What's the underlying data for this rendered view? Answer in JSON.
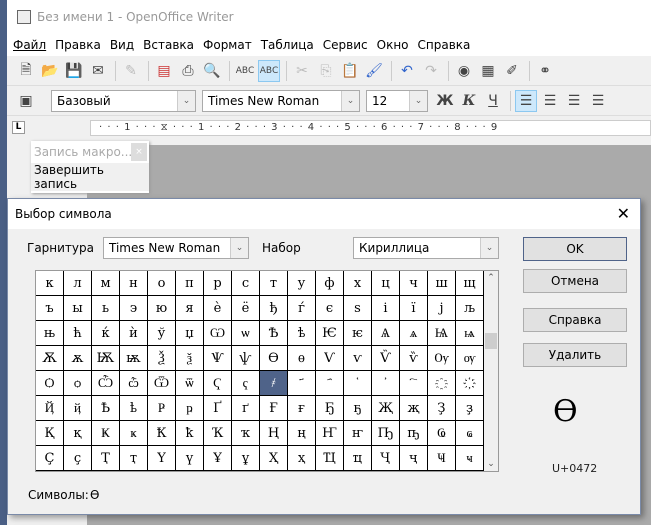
{
  "app": {
    "title": "Без имени 1 - OpenOffice Writer"
  },
  "menu": [
    "Файл",
    "Правка",
    "Вид",
    "Вставка",
    "Формат",
    "Таблица",
    "Сервис",
    "Окно",
    "Справка"
  ],
  "format_bar": {
    "style": "Базовый",
    "font": "Times New Roman",
    "size": "12",
    "bold": "Ж",
    "italic": "К",
    "underline": "Ч"
  },
  "ruler": {
    "labels": "· · · 1 · · · ⧖ · · · 1 · · · 2 · · · 3 · · · 4 · · · 5 · · · 6 · · · 7 · · · 8 · · · 9"
  },
  "macro_toolbar": {
    "title": "Запись макро...",
    "stop": "Завершить запись"
  },
  "dialog": {
    "title": "Выбор символа",
    "font_label": "Гарнитура",
    "font_value": "Times New Roman",
    "subset_label": "Набор",
    "subset_value": "Кириллица",
    "buttons": {
      "ok": "OK",
      "cancel": "Отмена",
      "help": "Справка",
      "delete": "Удалить"
    },
    "preview_char": "Ѳ",
    "code": "U+0472",
    "symbols_label": "Символы:",
    "symbols_value": "Ѳ",
    "selected_index": 72,
    "chars": [
      "к",
      "л",
      "м",
      "н",
      "о",
      "п",
      "р",
      "с",
      "т",
      "у",
      "ф",
      "х",
      "ц",
      "ч",
      "ш",
      "щ",
      "ъ",
      "ы",
      "ь",
      "э",
      "ю",
      "я",
      "ѐ",
      "ё",
      "ђ",
      "ѓ",
      "є",
      "ѕ",
      "і",
      "ї",
      "ј",
      "љ",
      "њ",
      "ћ",
      "ќ",
      "ѝ",
      "ў",
      "џ",
      "Ѡ",
      "ѡ",
      "Ѣ",
      "ѣ",
      "Ѥ",
      "ѥ",
      "Ѧ",
      "ѧ",
      "Ѩ",
      "ѩ",
      "Ѫ",
      "ѫ",
      "Ѭ",
      "ѭ",
      "Ѯ",
      "ѯ",
      "Ѱ",
      "ѱ",
      "Ѳ",
      "ѳ",
      "Ѵ",
      "ѵ",
      "Ѷ",
      "ѷ",
      "Ѹ",
      "ѹ",
      "Ѻ",
      "ѻ",
      "Ѽ",
      "ѽ",
      "Ѿ",
      "ѿ",
      "Ҁ",
      "ҁ",
      "҂",
      " ҃",
      " ҄",
      " ҅",
      " ҆",
      " ҇",
      " ҈",
      " ҉",
      "Ҋ",
      "ҋ",
      "Ҍ",
      "ҍ",
      "Ҏ",
      "ҏ",
      "Ґ",
      "ґ",
      "Ғ",
      "ғ",
      "Ҕ",
      "ҕ",
      "Җ",
      "җ",
      "Ҙ",
      "ҙ",
      "Қ",
      "қ",
      "Ҝ",
      "ҝ",
      "Ҟ",
      "ҟ",
      "Ҡ",
      "ҡ",
      "Ң",
      "ң",
      "Ҥ",
      "ҥ",
      "Ҧ",
      "ҧ",
      "Ҩ",
      "ҩ",
      "Ҫ",
      "ҫ",
      "Ҭ",
      "ҭ",
      "Ү",
      "ү",
      "Ұ",
      "ұ",
      "Ҳ",
      "ҳ",
      "Ҵ",
      "ҵ",
      "Ҷ",
      "ҷ",
      "Ҹ",
      "ҹ"
    ]
  },
  "colors": {
    "selection": "#4f6389",
    "accent": "#cde8fb"
  }
}
